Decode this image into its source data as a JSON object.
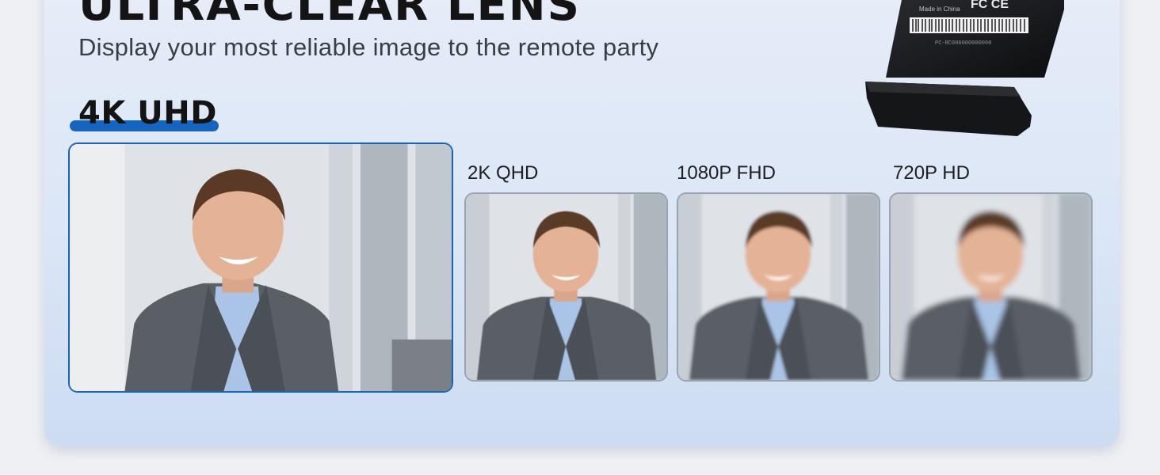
{
  "headline": "ULTRA-CLEAR LENS",
  "subtitle": "Display your most reliable image to the remote party",
  "badge": "4K UHD",
  "comparisons": [
    {
      "label": "2K QHD",
      "blur": 0.6
    },
    {
      "label": "1080P FHD",
      "blur": 1.8
    },
    {
      "label": "720P HD",
      "blur": 3.4
    }
  ],
  "device": {
    "made_in": "Made in China",
    "cert": "FC CE",
    "serial": "PC-RC000000000000"
  },
  "colors": {
    "accent": "#1565c0",
    "suit": "#5a5f66",
    "shirt": "#a9c4e6",
    "skin": "#e4b295",
    "hair": "#5a3a26"
  }
}
